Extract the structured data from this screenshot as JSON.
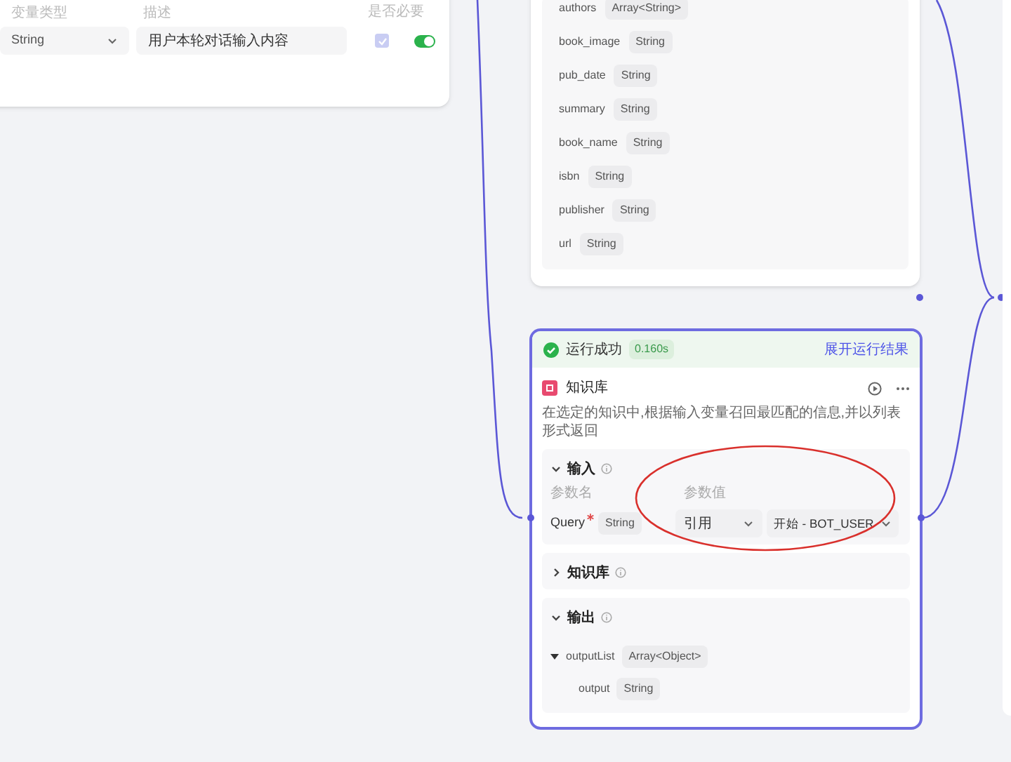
{
  "start_node": {
    "headers": [
      "变量类型",
      "描述",
      "是否必要"
    ],
    "params": [
      {
        "type": "String",
        "description": "用户本轮对话输入内容",
        "required": true,
        "enabled": true
      }
    ]
  },
  "output_node": {
    "fields": [
      {
        "name": "authors",
        "type": "Array<String>"
      },
      {
        "name": "book_image",
        "type": "String"
      },
      {
        "name": "pub_date",
        "type": "String"
      },
      {
        "name": "summary",
        "type": "String"
      },
      {
        "name": "book_name",
        "type": "String"
      },
      {
        "name": "isbn",
        "type": "String"
      },
      {
        "name": "publisher",
        "type": "String"
      },
      {
        "name": "url",
        "type": "String"
      }
    ]
  },
  "knowledge_node": {
    "status": {
      "text": "运行成功",
      "time": "0.160s",
      "link": "展开运行结果"
    },
    "title": "知识库",
    "description": "在选定的知识中,根据输入变量召回最匹配的信息,并以列表形式返回",
    "sections": [
      {
        "kind": "input",
        "title": "输入",
        "expanded": true,
        "headers": [
          "参数名",
          "参数值"
        ],
        "params": [
          {
            "name": "Query",
            "required": true,
            "type": "String",
            "source": "引用",
            "value": "开始 - BOT_USER"
          }
        ]
      },
      {
        "kind": "knowledge",
        "title": "知识库",
        "expanded": false
      },
      {
        "kind": "output",
        "title": "输出",
        "expanded": true,
        "tree": [
          {
            "name": "outputList",
            "type": "Array<Object>",
            "expanded": true,
            "children": [
              {
                "name": "output",
                "type": "String"
              }
            ]
          }
        ]
      }
    ]
  }
}
